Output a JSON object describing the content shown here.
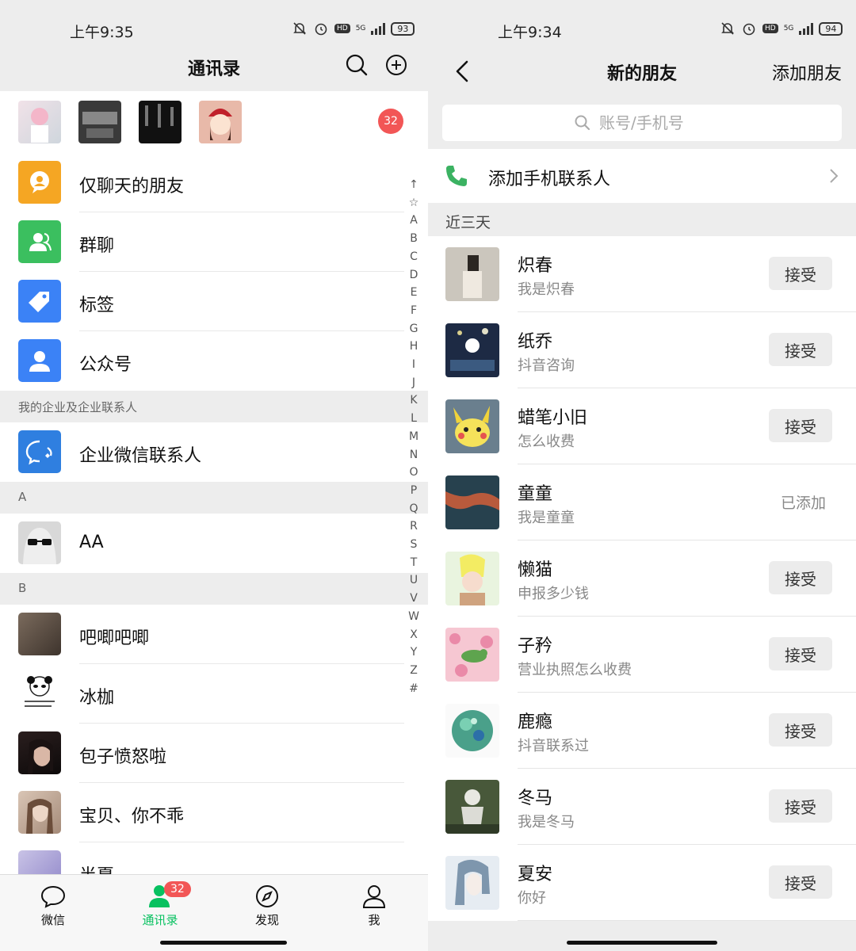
{
  "left": {
    "status": {
      "time": "上午9:35",
      "network": "5G",
      "battery": "93"
    },
    "header": {
      "title": "通讯录"
    },
    "new_friends": {
      "badge": "32"
    },
    "menu": [
      {
        "label": "仅聊天的朋友",
        "color": "#f5a623",
        "icon": "chat-bubble-icon"
      },
      {
        "label": "群聊",
        "color": "#3bbf5f",
        "icon": "group-person-icon"
      },
      {
        "label": "标签",
        "color": "#3b82f6",
        "icon": "tag-icon"
      },
      {
        "label": "公众号",
        "color": "#3b82f6",
        "icon": "official-account-person-icon"
      }
    ],
    "section_enterprise": "我的企业及企业联系人",
    "enterprise": {
      "label": "企业微信联系人",
      "color": "#2f7fe0"
    },
    "section_a": "A",
    "contacts_a": [
      {
        "name": "AA"
      }
    ],
    "section_b": "B",
    "contacts_b": [
      {
        "name": "吧唧吧唧"
      },
      {
        "name": "冰枷"
      },
      {
        "name": "包子愤怒啦"
      },
      {
        "name": "宝贝、你不乖"
      },
      {
        "name": "半夏"
      }
    ],
    "az_index": [
      "↑",
      "☆",
      "A",
      "B",
      "C",
      "D",
      "E",
      "F",
      "G",
      "H",
      "I",
      "J",
      "K",
      "L",
      "M",
      "N",
      "O",
      "P",
      "Q",
      "R",
      "S",
      "T",
      "U",
      "V",
      "W",
      "X",
      "Y",
      "Z",
      "#"
    ],
    "tabs": [
      {
        "label": "微信",
        "icon": "chat-icon"
      },
      {
        "label": "通讯录",
        "icon": "contacts-icon",
        "badge": "32",
        "active": true
      },
      {
        "label": "发现",
        "icon": "compass-icon"
      },
      {
        "label": "我",
        "icon": "person-icon"
      }
    ],
    "accent": "#07c160"
  },
  "right": {
    "status": {
      "time": "上午9:34",
      "network": "5G",
      "battery": "94"
    },
    "header": {
      "title": "新的朋友",
      "action": "添加朋友"
    },
    "search": {
      "placeholder": "账号/手机号"
    },
    "add_phone": {
      "label": "添加手机联系人"
    },
    "section": "近三天",
    "requests": [
      {
        "name": "炽春",
        "msg": "我是炽春",
        "state": "接受"
      },
      {
        "name": "纸乔",
        "msg": "抖音咨询",
        "state": "接受"
      },
      {
        "name": "蜡笔小旧",
        "msg": "怎么收费",
        "state": "接受"
      },
      {
        "name": "童童",
        "msg": "我是童童",
        "state": "已添加"
      },
      {
        "name": "懒猫",
        "msg": "申报多少钱",
        "state": "接受"
      },
      {
        "name": "子矜",
        "msg": "营业执照怎么收费",
        "state": "接受"
      },
      {
        "name": "鹿瘾",
        "msg": "抖音联系过",
        "state": "接受"
      },
      {
        "name": "冬马",
        "msg": "我是冬马",
        "state": "接受"
      },
      {
        "name": "夏安",
        "msg": "你好",
        "state": "接受"
      }
    ]
  }
}
